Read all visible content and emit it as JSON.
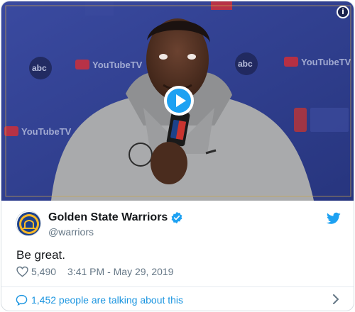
{
  "tweet": {
    "display_name": "Golden State Warriors",
    "handle": "@warriors",
    "text": "Be great.",
    "likes": "5,490",
    "timestamp": "3:41 PM - May 29, 2019",
    "conversation": "1,452 people are talking about this"
  },
  "media": {
    "backdrop_logos": [
      "YouTubeTV",
      "abc"
    ],
    "info_icon": "i"
  },
  "colors": {
    "accent": "#1da1f2",
    "link": "#1b95e0",
    "secondary_text": "#657786",
    "backdrop": "#2a3b8c",
    "youtube_red": "#e32d2d",
    "warriors_gold": "#fdb927",
    "warriors_blue": "#1d428a"
  },
  "icons": {
    "info": "info-icon",
    "play": "play-icon",
    "verified": "verified-badge-icon",
    "twitter": "twitter-bird-icon",
    "like": "heart-icon",
    "conversation": "speech-bubble-icon",
    "more": "chevron-right-icon"
  }
}
